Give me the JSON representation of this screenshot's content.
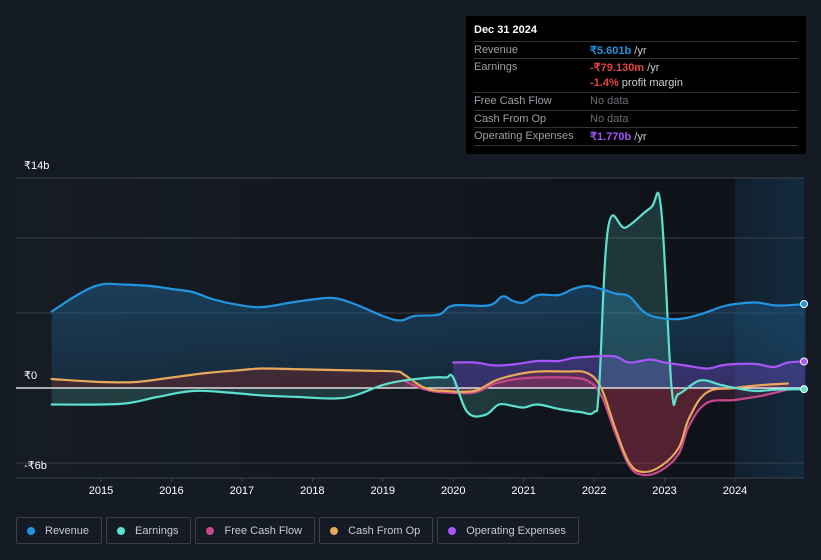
{
  "tooltip": {
    "date": "Dec 31 2024",
    "rows": [
      {
        "label": "Revenue",
        "value": "₹5.601b",
        "unit": " /yr"
      },
      {
        "label": "Earnings",
        "value": "-₹79.130m",
        "unit": " /yr"
      },
      {
        "label": "",
        "value": "-1.4%",
        "unit": " profit margin"
      },
      {
        "label": "Free Cash Flow",
        "value": "No data",
        "unit": ""
      },
      {
        "label": "Cash From Op",
        "value": "No data",
        "unit": ""
      },
      {
        "label": "Operating Expenses",
        "value": "₹1.770b",
        "unit": " /yr"
      }
    ]
  },
  "legend": [
    {
      "label": "Revenue",
      "color": "#2394df"
    },
    {
      "label": "Earnings",
      "color": "#5ee0cf"
    },
    {
      "label": "Free Cash Flow",
      "color": "#c7478c"
    },
    {
      "label": "Cash From Op",
      "color": "#e8a95a"
    },
    {
      "label": "Operating Expenses",
      "color": "#a855f7"
    }
  ],
  "chart_data": {
    "type": "area",
    "title": "",
    "xlabel": "",
    "ylabel": "",
    "ylim": [
      -6,
      14
    ],
    "xlim": [
      2014.3,
      2025.0
    ],
    "y_tick_labels": [
      {
        "value": 14,
        "label": "₹14b"
      },
      {
        "value": 0,
        "label": "₹0"
      },
      {
        "value": -6,
        "label": "-₹6b"
      }
    ],
    "gridlines": [
      14,
      10,
      5,
      0,
      -5
    ],
    "x_ticks": [
      2015,
      2016,
      2017,
      2018,
      2019,
      2020,
      2021,
      2022,
      2023,
      2024
    ],
    "forecast_region_start": 2024.0,
    "series": [
      {
        "name": "Revenue",
        "color": "#2394df",
        "x": [
          2014.3,
          2014.7,
          2015.0,
          2015.3,
          2015.7,
          2016.0,
          2016.3,
          2016.6,
          2017.0,
          2017.3,
          2017.7,
          2018.0,
          2018.3,
          2018.6,
          2019.0,
          2019.25,
          2019.45,
          2019.8,
          2020.0,
          2020.5,
          2020.7,
          2020.85,
          2021.0,
          2021.2,
          2021.5,
          2021.7,
          2021.9,
          2022.1,
          2022.3,
          2022.5,
          2022.7,
          2022.9,
          2023.2,
          2023.5,
          2023.8,
          2024.0,
          2024.3,
          2024.6,
          2025.0
        ],
        "values": [
          5.1,
          6.3,
          6.9,
          6.9,
          6.8,
          6.6,
          6.4,
          5.9,
          5.5,
          5.4,
          5.7,
          5.9,
          6.0,
          5.6,
          4.8,
          4.5,
          4.8,
          4.9,
          5.5,
          5.5,
          6.1,
          5.8,
          5.7,
          6.2,
          6.2,
          6.6,
          6.8,
          6.6,
          6.3,
          6.1,
          5.1,
          4.7,
          4.6,
          4.9,
          5.4,
          5.6,
          5.7,
          5.5,
          5.601
        ]
      },
      {
        "name": "Earnings",
        "color": "#5ee0cf",
        "x": [
          2014.3,
          2015.0,
          2015.4,
          2015.8,
          2016.3,
          2016.8,
          2017.3,
          2017.8,
          2018.3,
          2018.6,
          2019.0,
          2019.3,
          2019.7,
          2019.9,
          2020.0,
          2020.2,
          2020.45,
          2020.65,
          2020.85,
          2021.0,
          2021.2,
          2021.5,
          2021.8,
          2022.0,
          2022.07,
          2022.2,
          2022.45,
          2022.8,
          2022.95,
          2023.1,
          2023.2,
          2023.5,
          2023.8,
          2024.0,
          2024.3,
          2024.6,
          2025.0
        ],
        "values": [
          -1.1,
          -1.1,
          -1.0,
          -0.6,
          -0.2,
          -0.3,
          -0.5,
          -0.6,
          -0.7,
          -0.5,
          0.2,
          0.5,
          0.7,
          0.7,
          0.7,
          -1.6,
          -1.8,
          -1.1,
          -1.2,
          -1.3,
          -1.1,
          -1.4,
          -1.6,
          -1.6,
          0.0,
          10.7,
          10.7,
          12.0,
          12.0,
          0.0,
          -0.4,
          0.5,
          0.2,
          0.0,
          -0.2,
          -0.1,
          -0.079
        ]
      },
      {
        "name": "Free Cash Flow",
        "color": "#c7478c",
        "x": [
          2019.3,
          2019.6,
          2019.9,
          2020.3,
          2020.6,
          2020.9,
          2021.2,
          2021.6,
          2021.9,
          2022.1,
          2022.3,
          2022.5,
          2022.7,
          2022.95,
          2023.2,
          2023.35,
          2023.6,
          2024.0,
          2024.4,
          2024.75
        ],
        "values": [
          0.5,
          -0.1,
          -0.3,
          -0.3,
          0.3,
          0.6,
          0.7,
          0.7,
          0.5,
          -0.5,
          -3.0,
          -5.2,
          -5.8,
          -5.5,
          -4.4,
          -2.5,
          -1.0,
          -0.8,
          -0.5,
          -0.1
        ]
      },
      {
        "name": "Cash From Op",
        "color": "#e8a95a",
        "x": [
          2014.3,
          2015.0,
          2015.5,
          2016.0,
          2016.5,
          2017.0,
          2017.3,
          2017.8,
          2018.3,
          2018.8,
          2019.2,
          2019.3,
          2019.6,
          2019.9,
          2020.3,
          2020.6,
          2020.9,
          2021.2,
          2021.6,
          2021.9,
          2022.1,
          2022.3,
          2022.5,
          2022.7,
          2022.95,
          2023.2,
          2023.35,
          2023.6,
          2024.0,
          2024.4,
          2024.75
        ],
        "values": [
          0.6,
          0.4,
          0.4,
          0.7,
          1.0,
          1.2,
          1.3,
          1.25,
          1.2,
          1.15,
          1.1,
          0.9,
          0.0,
          -0.2,
          -0.2,
          0.5,
          0.9,
          1.1,
          1.1,
          1.0,
          0.0,
          -2.7,
          -5.0,
          -5.6,
          -5.2,
          -4.0,
          -2.0,
          -0.3,
          0.0,
          0.2,
          0.3
        ]
      },
      {
        "name": "Operating Expenses",
        "color": "#a855f7",
        "x": [
          2020.0,
          2020.3,
          2020.6,
          2020.9,
          2021.2,
          2021.5,
          2021.7,
          2022.0,
          2022.3,
          2022.5,
          2022.8,
          2023.0,
          2023.3,
          2023.6,
          2023.8,
          2024.0,
          2024.3,
          2024.55,
          2024.75,
          2025.0
        ],
        "values": [
          1.7,
          1.7,
          1.5,
          1.6,
          1.8,
          1.8,
          2.0,
          2.1,
          2.1,
          1.7,
          1.9,
          1.7,
          1.5,
          1.3,
          1.5,
          1.6,
          1.6,
          1.4,
          1.7,
          1.77
        ]
      }
    ]
  }
}
